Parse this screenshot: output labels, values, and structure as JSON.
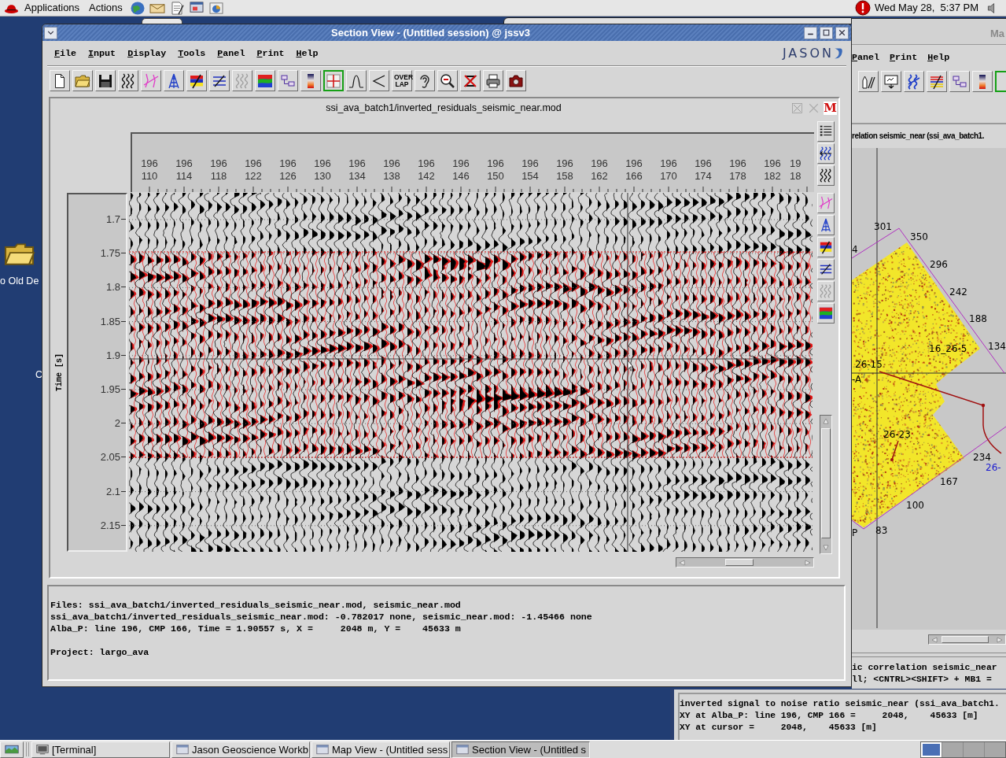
{
  "top_panel": {
    "menus": [
      "Applications",
      "Actions"
    ],
    "clock": "Wed May 28,  5:37 PM"
  },
  "desktop": {
    "icon_label": "o Old De",
    "label_fragment": "C"
  },
  "section_window": {
    "title": "Section View - (Untitled session) @ jssv3",
    "menus": [
      "File",
      "Input",
      "Display",
      "Tools",
      "Panel",
      "Print",
      "Help"
    ],
    "logo": "JASON",
    "toolbar": [
      {
        "selected": false
      },
      {
        "selected": false
      },
      {
        "selected": false
      },
      {
        "selected": false
      },
      {
        "selected": false
      },
      {
        "selected": false
      },
      {
        "selected": false
      },
      {
        "selected": false
      },
      {
        "selected": false
      },
      {
        "selected": false
      },
      {
        "selected": false
      },
      {
        "selected": false
      },
      {
        "selected": true
      },
      {
        "selected": false
      },
      {
        "selected": false
      },
      {
        "selected": false,
        "label": "OVER LAP"
      },
      {
        "selected": false
      },
      {
        "selected": false
      },
      {
        "selected": false
      },
      {
        "selected": false
      },
      {
        "selected": false
      }
    ],
    "panel": {
      "title": "ssi_ava_batch1/inverted_residuals_seismic_near.mod",
      "badge": "M",
      "traces": [
        {
          "line": "196",
          "cmp": "110"
        },
        {
          "line": "196",
          "cmp": "114"
        },
        {
          "line": "196",
          "cmp": "118"
        },
        {
          "line": "196",
          "cmp": "122"
        },
        {
          "line": "196",
          "cmp": "126"
        },
        {
          "line": "196",
          "cmp": "130"
        },
        {
          "line": "196",
          "cmp": "134"
        },
        {
          "line": "196",
          "cmp": "138"
        },
        {
          "line": "196",
          "cmp": "142"
        },
        {
          "line": "196",
          "cmp": "146"
        },
        {
          "line": "196",
          "cmp": "150"
        },
        {
          "line": "196",
          "cmp": "154"
        },
        {
          "line": "196",
          "cmp": "158"
        },
        {
          "line": "196",
          "cmp": "162"
        },
        {
          "line": "196",
          "cmp": "166"
        },
        {
          "line": "196",
          "cmp": "170"
        },
        {
          "line": "196",
          "cmp": "174"
        },
        {
          "line": "196",
          "cmp": "178"
        },
        {
          "line": "196",
          "cmp": "182"
        },
        {
          "line": "19",
          "cmp": "18"
        }
      ],
      "time_axis": {
        "label": "Time [s]",
        "ticks": [
          "1.7",
          "1.75",
          "1.8",
          "1.85",
          "1.9",
          "1.95",
          "2",
          "2.05",
          "2.1",
          "2.15"
        ]
      }
    },
    "info": {
      "lines": [
        "Files: ssi_ava_batch1/inverted_residuals_seismic_near.mod, seismic_near.mod",
        "ssi_ava_batch1/inverted_residuals_seismic_near.mod: -0.782017 none, seismic_near.mod: -1.45466 none",
        "Alba_P: line 196, CMP 166, Time = 1.90557 s, X =     2048 m, Y =    45633 m"
      ],
      "project": "Project: largo_ava"
    }
  },
  "map_window": {
    "title": "Ma",
    "menus": [
      "Panel",
      "Print",
      "Help"
    ],
    "toolbar": [
      {
        "selected": false
      },
      {
        "selected": false
      },
      {
        "selected": false
      },
      {
        "selected": false
      },
      {
        "selected": false
      },
      {
        "selected": false
      },
      {
        "selected": true
      }
    ],
    "caption": "relation seismic_near (ssi_ava_batch1.",
    "labels": [
      {
        "text": "301",
        "color": "#000000"
      },
      {
        "text": "350",
        "color": "#000000"
      },
      {
        "text": "4",
        "color": "#000000"
      },
      {
        "text": "296",
        "color": "#000000"
      },
      {
        "text": "242",
        "color": "#000000"
      },
      {
        "text": "188",
        "color": "#000000"
      },
      {
        "text": "134",
        "color": "#000000"
      },
      {
        "text": "16_26-5",
        "color": "#000000"
      },
      {
        "text": "26-15",
        "color": "#000000"
      },
      {
        "text": "-A",
        "color": "#000000"
      },
      {
        "text": "26-23",
        "color": "#000000"
      },
      {
        "text": "234",
        "color": "#000000"
      },
      {
        "text": "26-",
        "color": "#1a1ad0"
      },
      {
        "text": "167",
        "color": "#000000"
      },
      {
        "text": "100",
        "color": "#000000"
      },
      {
        "text": "83",
        "color": "#000000"
      },
      {
        "text": "P",
        "color": "#000000"
      }
    ],
    "status_lines": [
      "ic correlation seismic_near",
      "ll; <CNTRL><SHIFT> + MB1 ="
    ]
  },
  "info_window": {
    "lines": [
      "inverted signal to noise ratio seismic_near (ssi_ava_batch1.",
      "XY at Alba_P: line 196, CMP 166 =     2048,    45633 [m]",
      "XY at cursor =     2048,    45633 [m]"
    ]
  },
  "taskbar": {
    "tasks": [
      {
        "label": "[Terminal]",
        "selected": false
      },
      {
        "label": "Jason Geoscience Workb",
        "selected": false
      },
      {
        "label": "Map View - (Untitled sess",
        "selected": false
      },
      {
        "label": "Section View - (Untitled s",
        "selected": true
      }
    ],
    "workspaces": [
      {
        "selected": true
      },
      {
        "selected": false
      },
      {
        "selected": false
      },
      {
        "selected": false
      }
    ]
  }
}
